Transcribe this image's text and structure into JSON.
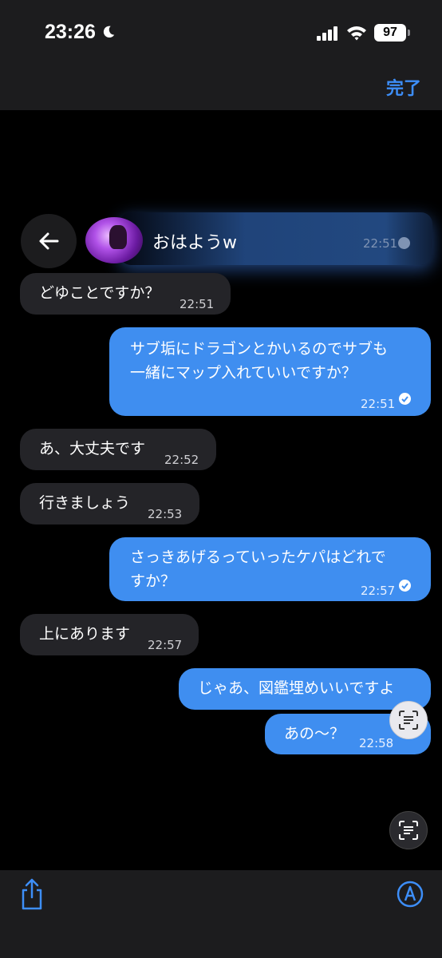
{
  "status_bar": {
    "time": "23:26",
    "battery": "97"
  },
  "top_bar": {
    "done_label": "完了"
  },
  "chat_header": {
    "name": "おはようw",
    "timestamp": "22:51"
  },
  "messages": [
    {
      "direction": "incoming",
      "text": "どゆことですか？",
      "time": "22:51"
    },
    {
      "direction": "outgoing",
      "lines": [
        "サブ垢にドラゴンとかいるのでサブも",
        "一緒にマップ入れていいですか？"
      ],
      "time": "22:51"
    },
    {
      "direction": "incoming",
      "text": "あ、大丈夫です",
      "time": "22:52"
    },
    {
      "direction": "incoming",
      "text": "行きましょう",
      "time": "22:53"
    },
    {
      "direction": "outgoing",
      "lines": [
        "さっきあげるっていったケパはどれで",
        "すか？"
      ],
      "time": "22:57"
    },
    {
      "direction": "incoming",
      "text": "上にあります",
      "time": "22:57"
    },
    {
      "direction": "outgoing",
      "text": "じゃあ、図鑑埋めいいですよ",
      "time": ""
    },
    {
      "direction": "outgoing",
      "text": "あの〜？",
      "time": "22:58"
    }
  ],
  "colors": {
    "accent": "#3d8ef8",
    "outgoing_bubble": "#3f8ef0",
    "incoming_bubble": "#242428"
  }
}
